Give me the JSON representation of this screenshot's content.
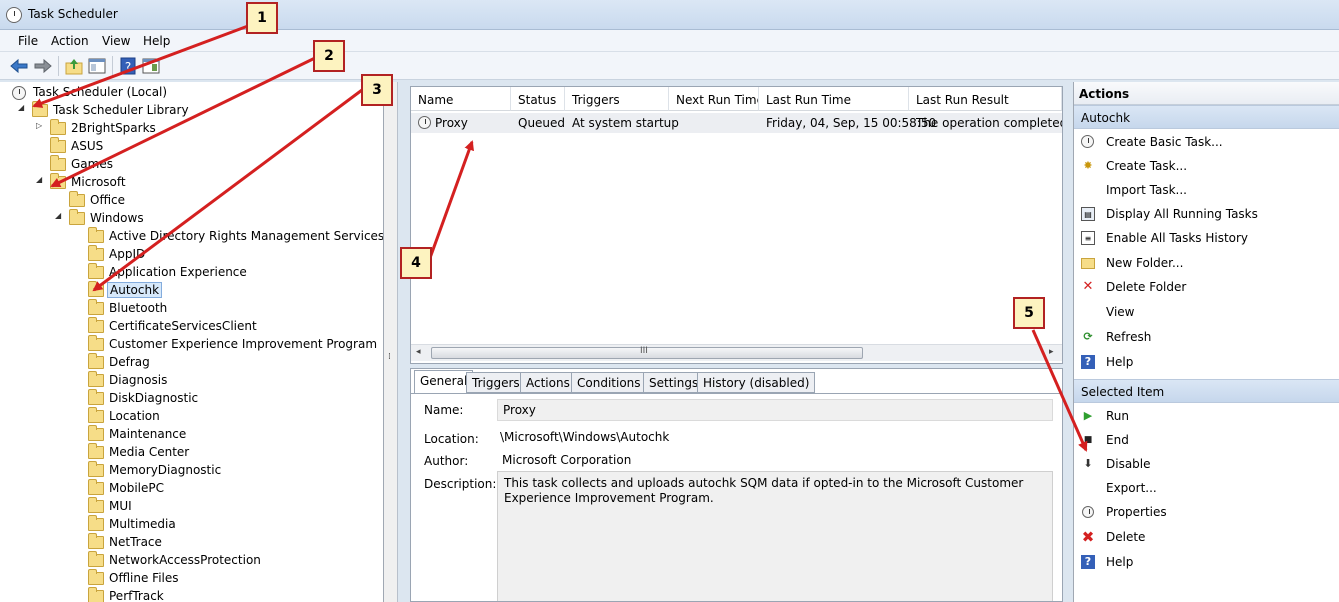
{
  "window": {
    "title": "Task Scheduler"
  },
  "menu": [
    "File",
    "Action",
    "View",
    "Help"
  ],
  "tree": {
    "root": "Task Scheduler (Local)",
    "library": "Task Scheduler Library",
    "items": [
      {
        "label": "2BrightSparks"
      },
      {
        "label": "ASUS"
      },
      {
        "label": "Games"
      },
      {
        "label": "Microsoft"
      },
      {
        "label": "Office"
      },
      {
        "label": "Windows"
      },
      {
        "label": "Active Directory Rights Management Services Client"
      },
      {
        "label": "AppID"
      },
      {
        "label": "Application Experience"
      },
      {
        "label": "Autochk"
      },
      {
        "label": "Bluetooth"
      },
      {
        "label": "CertificateServicesClient"
      },
      {
        "label": "Customer Experience Improvement Program"
      },
      {
        "label": "Defrag"
      },
      {
        "label": "Diagnosis"
      },
      {
        "label": "DiskDiagnostic"
      },
      {
        "label": "Location"
      },
      {
        "label": "Maintenance"
      },
      {
        "label": "Media Center"
      },
      {
        "label": "MemoryDiagnostic"
      },
      {
        "label": "MobilePC"
      },
      {
        "label": "MUI"
      },
      {
        "label": "Multimedia"
      },
      {
        "label": "NetTrace"
      },
      {
        "label": "NetworkAccessProtection"
      },
      {
        "label": "Offline Files"
      },
      {
        "label": "PerfTrack"
      }
    ]
  },
  "task_list": {
    "columns": [
      "Name",
      "Status",
      "Triggers",
      "Next Run Time",
      "Last Run Time",
      "Last Run Result"
    ],
    "rows": [
      [
        "Proxy",
        "Queued",
        "At system startup",
        "",
        "Friday, 04, Sep, 15 00:58:50",
        "The operation completed su"
      ]
    ],
    "scroll_grip": "III"
  },
  "detail": {
    "tabs": [
      "General",
      "Triggers",
      "Actions",
      "Conditions",
      "Settings",
      "History (disabled)"
    ],
    "name_label": "Name:",
    "name_value": "Proxy",
    "location_label": "Location:",
    "location_value": "\\Microsoft\\Windows\\Autochk",
    "author_label": "Author:",
    "author_value": "Microsoft Corporation",
    "description_label": "Description:",
    "description_value": "This task collects and uploads autochk SQM data if opted-in to the Microsoft Customer Experience Improvement Program."
  },
  "actions": {
    "header": "Actions",
    "folder_section": "Autochk",
    "folder_items": [
      {
        "label": "Create Basic Task...",
        "icon": "create-basic-task-icon"
      },
      {
        "label": "Create Task...",
        "icon": "create-task-icon"
      },
      {
        "label": "Import Task...",
        "icon": ""
      },
      {
        "label": "Display All Running Tasks",
        "icon": "running-tasks-icon"
      },
      {
        "label": "Enable All Tasks History",
        "icon": "history-icon"
      },
      {
        "label": "New Folder...",
        "icon": "new-folder-icon"
      },
      {
        "label": "Delete Folder",
        "icon": "delete-icon"
      },
      {
        "label": "View",
        "icon": ""
      },
      {
        "label": "Refresh",
        "icon": "refresh-icon"
      },
      {
        "label": "Help",
        "icon": "help-icon"
      }
    ],
    "item_section": "Selected Item",
    "item_items": [
      {
        "label": "Run",
        "icon": "run-icon"
      },
      {
        "label": "End",
        "icon": "end-icon"
      },
      {
        "label": "Disable",
        "icon": "disable-icon"
      },
      {
        "label": "Export...",
        "icon": ""
      },
      {
        "label": "Properties",
        "icon": "properties-icon"
      },
      {
        "label": "Delete",
        "icon": "delete-icon"
      },
      {
        "label": "Help",
        "icon": "help-icon"
      }
    ]
  },
  "callouts": [
    "1",
    "2",
    "3",
    "4",
    "5"
  ],
  "colors": {
    "arrow": "#d42020",
    "selection": "#d6e8fa",
    "section": "#c6d7ec"
  }
}
